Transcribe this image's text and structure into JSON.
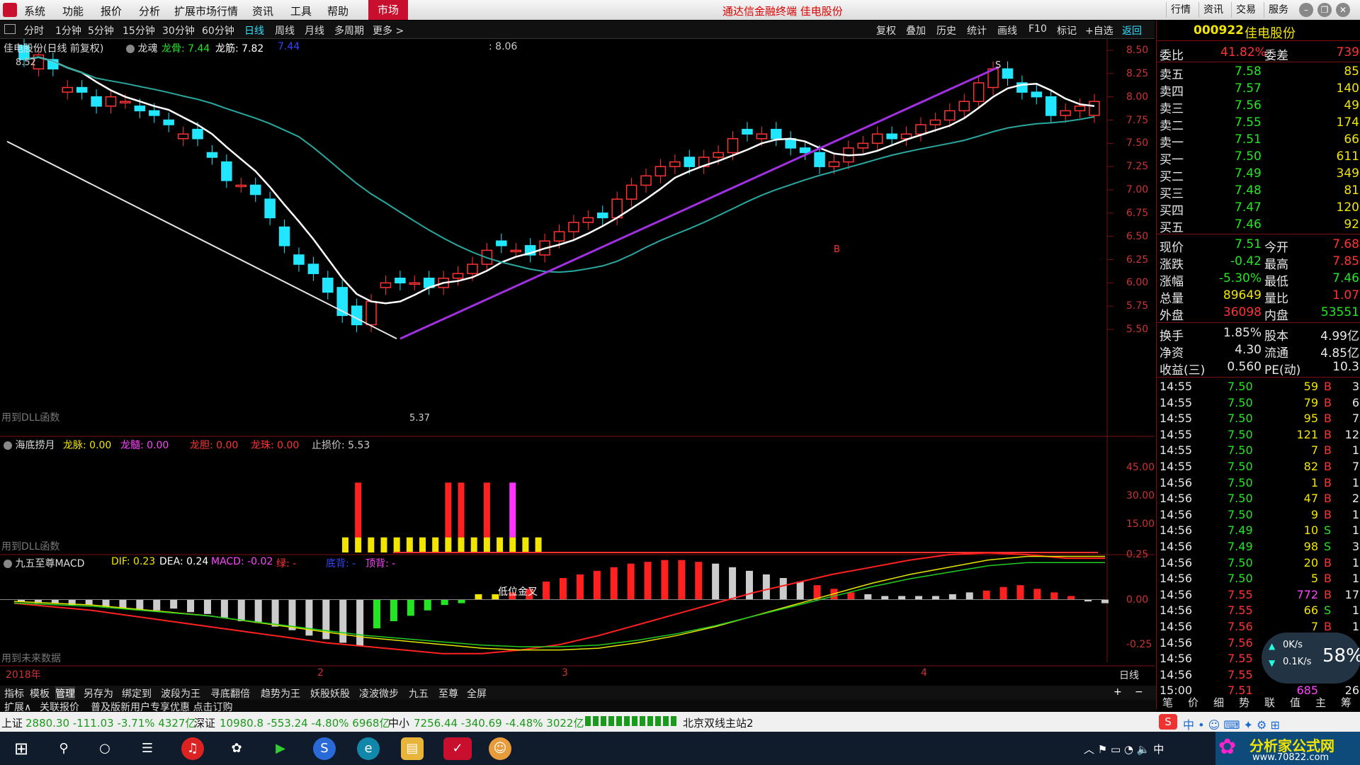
{
  "menu": {
    "items": [
      "系统",
      "功能",
      "报价",
      "分析",
      "扩展市场行情",
      "资讯",
      "工具",
      "帮助"
    ],
    "market": "市场",
    "window_title": "通达信金融终端  佳电股份",
    "right_buttons": [
      "行情",
      "资讯",
      "交易",
      "服务"
    ]
  },
  "periods": {
    "items": [
      "分时",
      "1分钟",
      "5分钟",
      "15分钟",
      "30分钟",
      "60分钟",
      "日线",
      "周线",
      "月线",
      "多周期",
      "更多 >"
    ],
    "active": "日线",
    "tools": [
      "复权",
      "叠加",
      "历史",
      "统计",
      "画线",
      "F10",
      "标记",
      "+自选",
      "返回"
    ]
  },
  "main_chart": {
    "title": "佳电股份(日线 前复权)",
    "indicator": "龙魂",
    "v1_label": "龙骨: 7.44",
    "v2_label": "龙筋: 7.82",
    "v3_label": "7.44",
    "cursor_value": ": 8.06",
    "top_left_price": "8.52",
    "low_label": "5.37",
    "s_label": "S",
    "b_label": "B",
    "dll_note": "用到DLL函数",
    "y_ticks": [
      "8.50",
      "8.25",
      "8.00",
      "7.75",
      "7.50",
      "7.25",
      "7.00",
      "6.75",
      "6.50",
      "6.25",
      "6.00",
      "5.75",
      "5.50"
    ]
  },
  "sub1": {
    "title": "海底捞月",
    "l1": "龙脉: 0.00",
    "l2": "龙髓: 0.00",
    "l3": "龙胆: 0.00",
    "l4": "龙珠: 0.00",
    "l5": "止损价: 5.53",
    "note": "用到DLL函数",
    "y_ticks": [
      "45.00",
      "30.00",
      "15.00"
    ]
  },
  "sub2": {
    "title": "九五至尊MACD",
    "dif": "DIF: 0.23",
    "dea": "DEA: 0.24",
    "macd": "MACD: -0.02",
    "l4": "绿: -",
    "l5": "底背: -",
    "l6": "顶背: -",
    "annotation": "低位金叉",
    "note": "用到未来数据",
    "y_ticks": [
      "0.25",
      "0.00",
      "-0.25"
    ]
  },
  "x_axis": {
    "labels": [
      "2018年",
      "2",
      "3",
      "4"
    ],
    "right_label": "日线"
  },
  "bottom_tabs": [
    "指标",
    "模板",
    "管理",
    "另存为",
    "绑定到",
    "波段为王",
    "寻底翻倍",
    "趋势为王",
    "妖股妖股",
    "凌波微步",
    "九五",
    "至尊",
    "全屏"
  ],
  "bottom_tabs_active": "管理",
  "ext_bar": {
    "items": [
      "扩展∧",
      "关联报价",
      "普及版新用户专享优惠  点击订购"
    ]
  },
  "quote": {
    "code": "000922",
    "name": "佳电股份",
    "weibi_label": "委比",
    "weibi": "41.82%",
    "weicha_label": "委差",
    "weicha": "739",
    "sell": [
      {
        "label": "卖五",
        "price": "7.58",
        "vol": "85"
      },
      {
        "label": "卖四",
        "price": "7.57",
        "vol": "140"
      },
      {
        "label": "卖三",
        "price": "7.56",
        "vol": "49"
      },
      {
        "label": "卖二",
        "price": "7.55",
        "vol": "174"
      },
      {
        "label": "卖一",
        "price": "7.51",
        "vol": "66"
      }
    ],
    "buy": [
      {
        "label": "买一",
        "price": "7.50",
        "vol": "611"
      },
      {
        "label": "买二",
        "price": "7.49",
        "vol": "349"
      },
      {
        "label": "买三",
        "price": "7.48",
        "vol": "81"
      },
      {
        "label": "买四",
        "price": "7.47",
        "vol": "120"
      },
      {
        "label": "买五",
        "price": "7.46",
        "vol": "92"
      }
    ],
    "stats": [
      {
        "l1": "现价",
        "v1": "7.51",
        "l2": "今开",
        "v2": "7.68"
      },
      {
        "l1": "涨跌",
        "v1": "-0.42",
        "l2": "最高",
        "v2": "7.85"
      },
      {
        "l1": "涨幅",
        "v1": "-5.30%",
        "l2": "最低",
        "v2": "7.46"
      },
      {
        "l1": "总量",
        "v1": "89649",
        "l2": "量比",
        "v2": "1.07"
      },
      {
        "l1": "外盘",
        "v1": "36098",
        "l2": "内盘",
        "v2": "53551"
      }
    ],
    "stats2": [
      {
        "l1": "换手",
        "v1": "1.85%",
        "l2": "股本",
        "v2": "4.99亿"
      },
      {
        "l1": "净资",
        "v1": "4.30",
        "l2": "流通",
        "v2": "4.85亿"
      },
      {
        "l1": "收益(三)",
        "v1": "0.560",
        "l2": "PE(动)",
        "v2": "10.3"
      }
    ],
    "ticks": [
      {
        "t": "14:55",
        "p": "7.50",
        "v": "59",
        "s": "B",
        "n": "3"
      },
      {
        "t": "14:55",
        "p": "7.50",
        "v": "79",
        "s": "B",
        "n": "6"
      },
      {
        "t": "14:55",
        "p": "7.50",
        "v": "95",
        "s": "B",
        "n": "7"
      },
      {
        "t": "14:55",
        "p": "7.50",
        "v": "121",
        "s": "B",
        "n": "12"
      },
      {
        "t": "14:55",
        "p": "7.50",
        "v": "7",
        "s": "B",
        "n": "1"
      },
      {
        "t": "14:55",
        "p": "7.50",
        "v": "82",
        "s": "B",
        "n": "7"
      },
      {
        "t": "14:56",
        "p": "7.50",
        "v": "1",
        "s": "B",
        "n": "1"
      },
      {
        "t": "14:56",
        "p": "7.50",
        "v": "47",
        "s": "B",
        "n": "2"
      },
      {
        "t": "14:56",
        "p": "7.50",
        "v": "9",
        "s": "B",
        "n": "1"
      },
      {
        "t": "14:56",
        "p": "7.49",
        "v": "10",
        "s": "S",
        "n": "1"
      },
      {
        "t": "14:56",
        "p": "7.49",
        "v": "98",
        "s": "S",
        "n": "3"
      },
      {
        "t": "14:56",
        "p": "7.50",
        "v": "20",
        "s": "B",
        "n": "1"
      },
      {
        "t": "14:56",
        "p": "7.50",
        "v": "5",
        "s": "B",
        "n": "1"
      },
      {
        "t": "14:56",
        "p": "7.55",
        "v": "772",
        "s": "B",
        "n": "17"
      },
      {
        "t": "14:56",
        "p": "7.55",
        "v": "66",
        "s": "S",
        "n": "1"
      },
      {
        "t": "14:56",
        "p": "7.56",
        "v": "7",
        "s": "B",
        "n": "1"
      },
      {
        "t": "14:56",
        "p": "7.56",
        "v": "",
        "s": "",
        "n": ""
      },
      {
        "t": "14:56",
        "p": "7.55",
        "v": "",
        "s": "",
        "n": ""
      },
      {
        "t": "14:56",
        "p": "7.55",
        "v": "",
        "s": "",
        "n": ""
      },
      {
        "t": "15:00",
        "p": "7.51",
        "v": "685",
        "s": "",
        "n": "26"
      }
    ],
    "speed_up": "0K/s",
    "speed_down": "0.1K/s",
    "cpu": "58%",
    "panel_tabs": [
      "笔",
      "价",
      "细",
      "势",
      "联",
      "值",
      "主",
      "筹"
    ]
  },
  "status": {
    "sh_label": "上证",
    "sh": "2880.30 -111.03 -3.71% 4327亿",
    "sz_label": "深证",
    "sz": "10980.8 -553.24 -4.80% 6968亿",
    "zx_label": "中小",
    "zx": "7256.44 -340.69 -4.48% 3022亿",
    "server": "北京双线主站2"
  },
  "taskbar": {
    "watermark": "分析家公式网",
    "watermark_url": "www.70822.com"
  },
  "colors": {
    "up": "#ff3333",
    "down": "#22e6ff",
    "trend": "#a030e0",
    "ma_white": "#ffffff",
    "ma_teal": "#2aa8a0"
  }
}
